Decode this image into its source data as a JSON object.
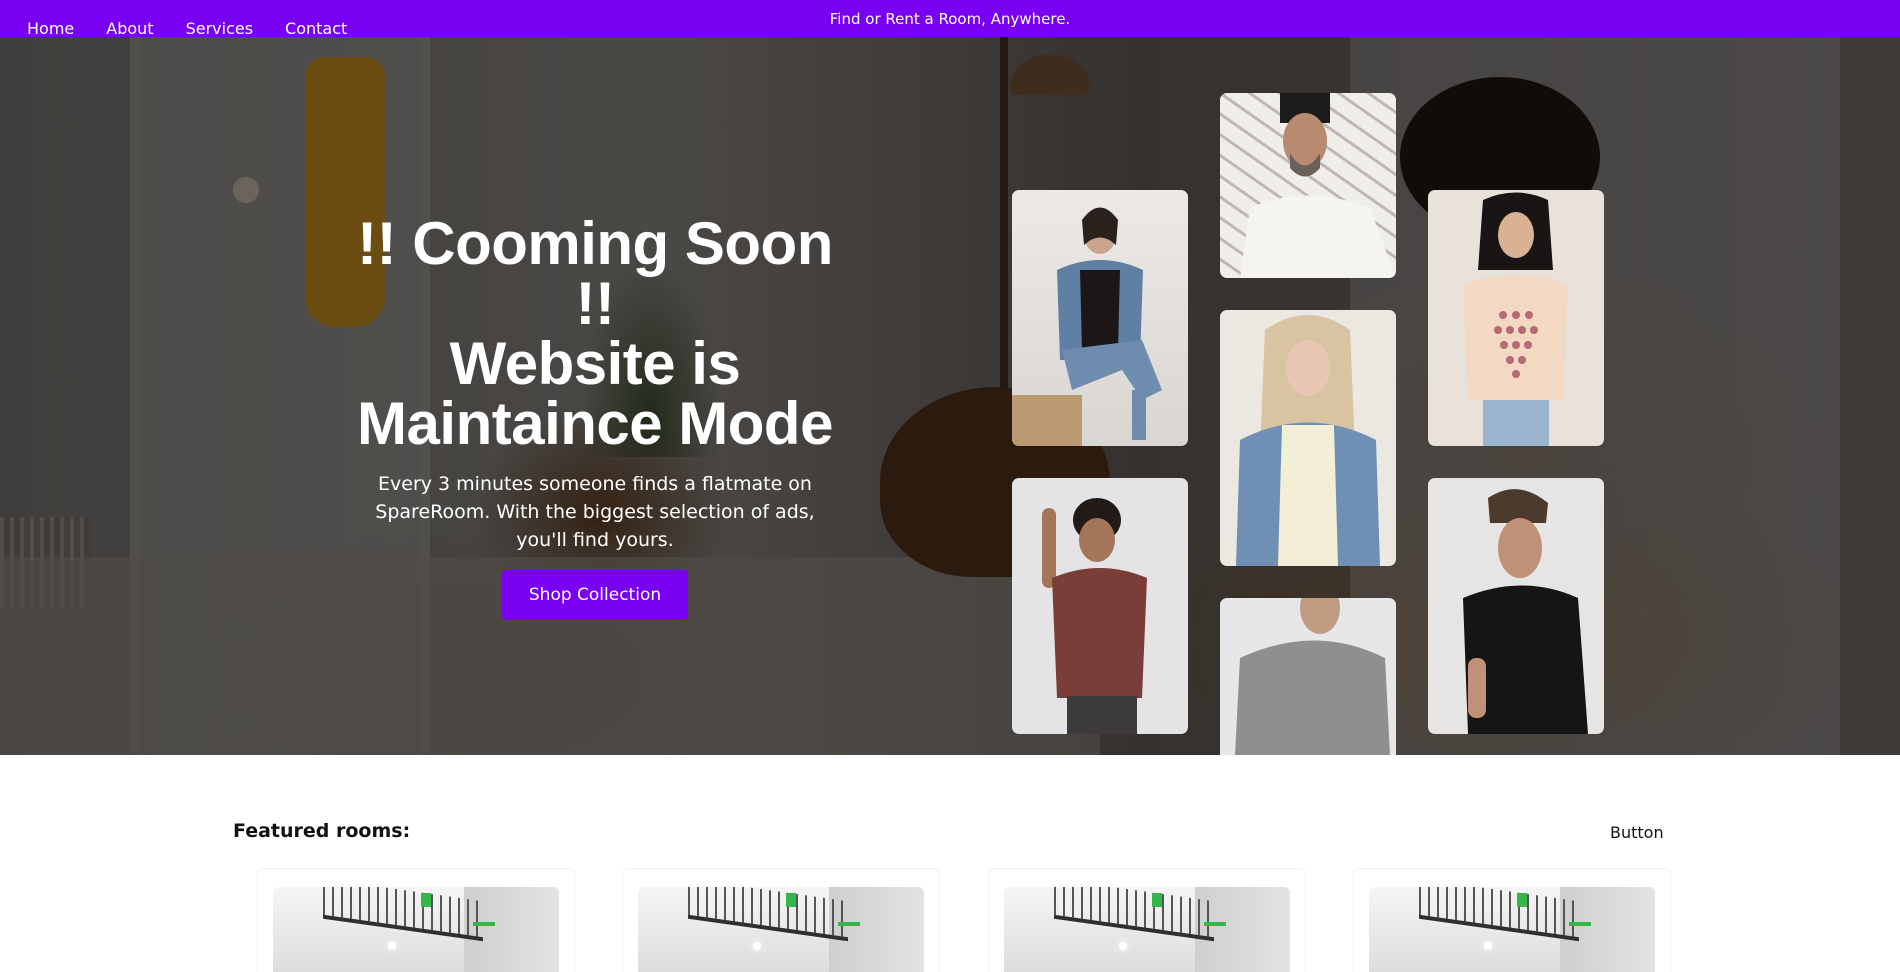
{
  "announcement": "Find or Rent a Room, Anywhere.",
  "nav": [
    "Home",
    "About",
    "Services",
    "Contact"
  ],
  "hero": {
    "title_lines": [
      "!! Cooming Soon !!",
      "Website is",
      "Maintaince Mode"
    ],
    "subtitle": "Every 3 minutes someone finds a flatmate on SpareRoom. With the biggest selection of ads, you'll find yours.",
    "cta": "Shop Collection"
  },
  "gallery": [
    "woman-denim-jacket-photo",
    "man-white-tee-photo",
    "woman-graphic-tee-photo",
    "woman-blonde-denim-photo",
    "man-maroon-tee-photo",
    "man-black-tee-photo",
    "man-gray-tee-photo"
  ],
  "featured": {
    "title": "Featured rooms:",
    "button": "Button"
  },
  "colors": {
    "accent": "#7a00f2"
  }
}
